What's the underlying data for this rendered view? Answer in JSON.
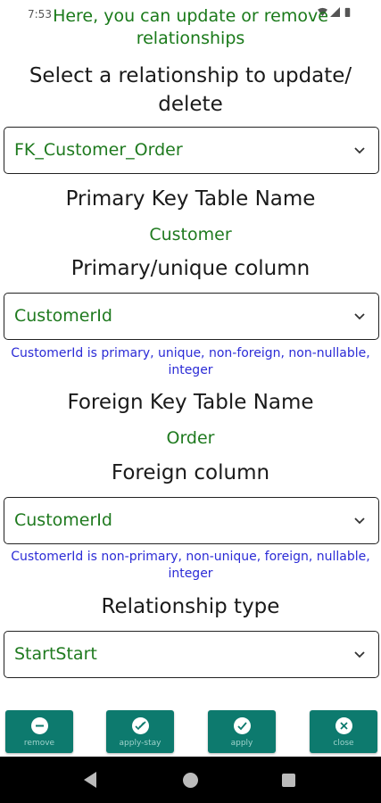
{
  "status": {
    "time": "7:53"
  },
  "header": {
    "message": "Here, you can update or remove relationships"
  },
  "select_relationship": {
    "title": "Select a relationship to update/ delete",
    "value": "FK_Customer_Order"
  },
  "primary": {
    "table_label": "Primary Key Table Name",
    "table_value": "Customer",
    "column_label": "Primary/unique column",
    "column_value": "CustomerId",
    "column_info": "CustomerId is primary, unique, non-foreign, non-nullable, integer"
  },
  "foreign": {
    "table_label": "Foreign Key Table Name",
    "table_value": "Order",
    "column_label": "Foreign column",
    "column_value": "CustomerId",
    "column_info": "CustomerId is non-primary, non-unique, foreign, nullable, integer"
  },
  "relationship_type": {
    "label": "Relationship type",
    "value": "StartStart"
  },
  "actions": {
    "remove": "remove",
    "apply_stay": "apply-stay",
    "apply": "apply",
    "close": "close"
  },
  "colors": {
    "accent_green": "#1f7a1f",
    "info_blue": "#2b2bd6",
    "button_teal": "#0d7a6e"
  }
}
